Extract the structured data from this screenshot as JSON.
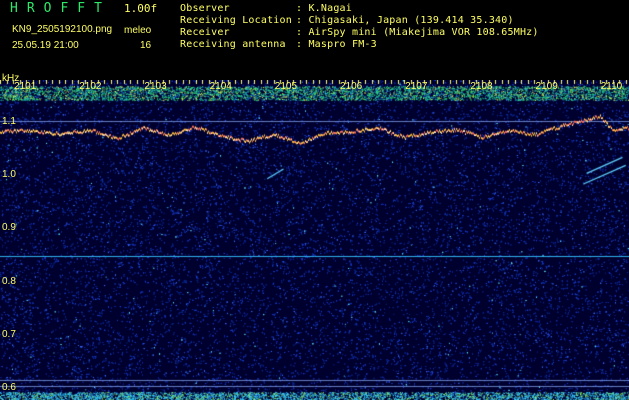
{
  "header": {
    "logo": "HROFFT",
    "version": "1.00f",
    "filename": "KN9_2505192100.png",
    "meleo_label": "meleo",
    "meleo_value": "16",
    "timestamp": "25.05.19 21:00",
    "info": [
      {
        "key": "Observer",
        "value": ": K.Nagai"
      },
      {
        "key": "Receiving Location",
        "value": ": Chigasaki, Japan (139.414 35.340)"
      },
      {
        "key": "Receiver",
        "value": ": AirSpy mini (Miakejima VOR 108.65MHz)"
      },
      {
        "key": "Receiving antenna",
        "value": ": Maspro FM-3"
      }
    ]
  },
  "chart_data": {
    "type": "heatmap",
    "ylabel": "kHz",
    "y_ticks": [
      "1.1",
      "1.0",
      "0.9",
      "0.8",
      "0.7",
      "0.6"
    ],
    "y_tick_values": [
      1.1,
      1.0,
      0.9,
      0.8,
      0.7,
      0.6
    ],
    "x_ticks": [
      "2101",
      "2102",
      "2103",
      "2104",
      "2105",
      "2106",
      "2107",
      "2108",
      "2109",
      "2110"
    ],
    "x_tick_values": [
      2101,
      2102,
      2103,
      2104,
      2105,
      2106,
      2107,
      2108,
      2109,
      2110
    ],
    "ylim": [
      0.58,
      1.18
    ],
    "xlim": [
      2100.6,
      2110.25
    ],
    "carrier_trace": {
      "x": [
        2100.6,
        2101.0,
        2101.5,
        2102.0,
        2102.4,
        2102.8,
        2103.2,
        2103.6,
        2104.0,
        2104.4,
        2104.8,
        2105.2,
        2105.6,
        2106.0,
        2106.4,
        2106.8,
        2107.2,
        2107.6,
        2108.0,
        2108.4,
        2108.8,
        2109.2,
        2109.5,
        2109.8,
        2110.0,
        2110.25
      ],
      "y": [
        1.083,
        1.085,
        1.079,
        1.085,
        1.07,
        1.09,
        1.077,
        1.092,
        1.074,
        1.065,
        1.078,
        1.06,
        1.081,
        1.083,
        1.09,
        1.072,
        1.082,
        1.087,
        1.072,
        1.085,
        1.077,
        1.093,
        1.102,
        1.112,
        1.085,
        1.09
      ]
    },
    "horizontal_lines_khz": [
      1.104,
      0.85,
      0.617,
      0.607
    ],
    "meteor_streaks": [
      {
        "x": [
          2104.7,
          2104.95
        ],
        "y": [
          0.995,
          1.013
        ]
      },
      {
        "x": [
          2109.55,
          2110.2
        ],
        "y": [
          0.985,
          1.02
        ]
      },
      {
        "x": [
          2109.6,
          2110.15
        ],
        "y": [
          1.005,
          1.035
        ]
      }
    ],
    "colors": {
      "background": "#00002e",
      "noise": "#1b3fd1",
      "trace": "#ffbf3f",
      "line": "#33c4ff",
      "band": "#2ee86a",
      "text": "#ffff66"
    }
  }
}
